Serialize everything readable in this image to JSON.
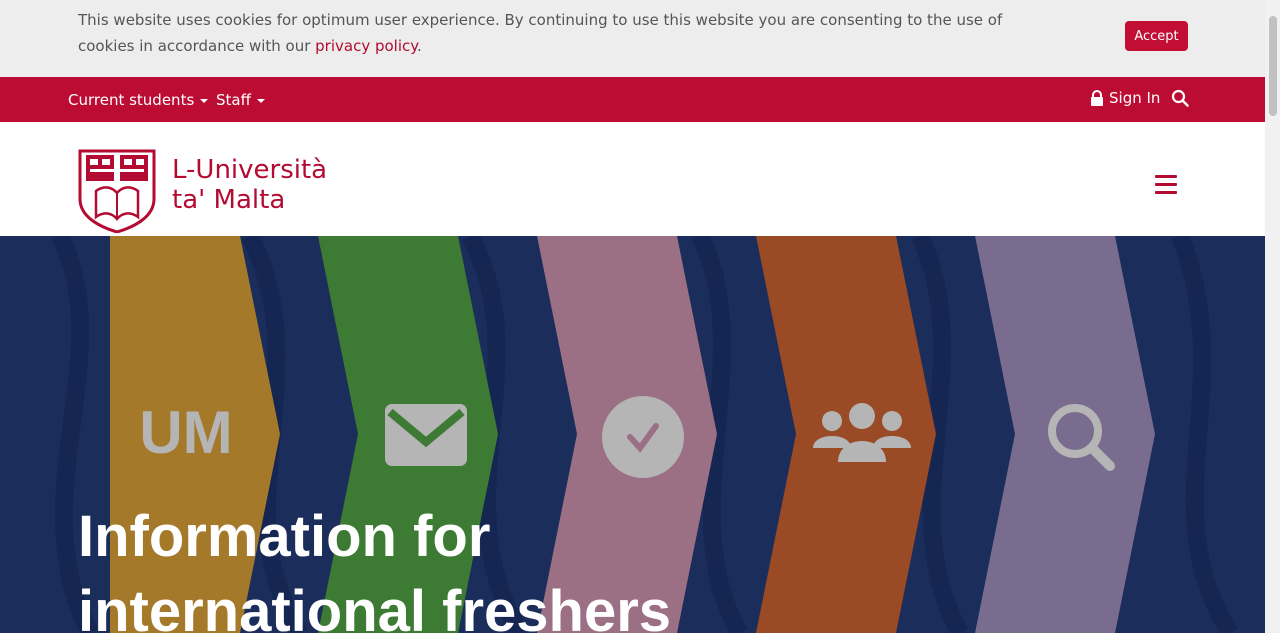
{
  "cookie": {
    "text": "This website uses cookies for optimum user experience. By continuing to use this website you are consenting to the use of cookies in accordance with our ",
    "link": "privacy policy",
    "end": ".",
    "accept": "Accept"
  },
  "nav": {
    "current_students": "Current students",
    "staff": "Staff",
    "sign_in": "Sign In"
  },
  "brand": {
    "line1": "L-Università",
    "line2": "ta' Malta"
  },
  "hero": {
    "title": "Information for international freshers",
    "icon_um": "UM"
  },
  "colors": {
    "primary": "#bd0c33",
    "hero_bg": "#1b2d5a",
    "chevrons": [
      "#a5792a",
      "#3d7a34",
      "#9b6f84",
      "#9a4a24",
      "#7a6c8f"
    ]
  },
  "icons": [
    "lock-icon",
    "search-icon",
    "hamburger-icon",
    "envelope-icon",
    "check-circle-icon",
    "users-icon",
    "magnifier-icon"
  ]
}
